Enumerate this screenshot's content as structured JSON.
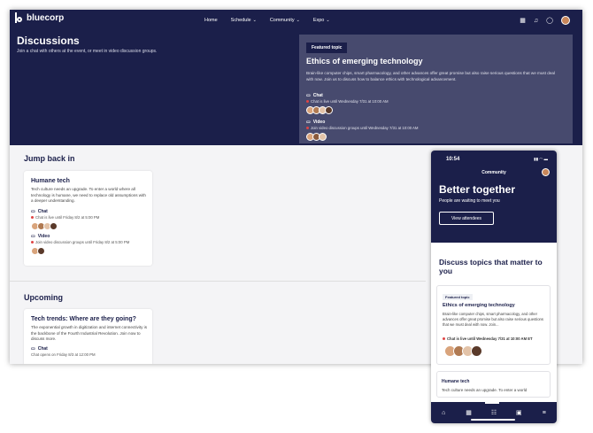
{
  "brand": {
    "name": "bluecorp"
  },
  "nav": {
    "items": [
      {
        "label": "Home"
      },
      {
        "label": "Schedule",
        "has_dropdown": true
      },
      {
        "label": "Community",
        "has_dropdown": true
      },
      {
        "label": "Expo",
        "has_dropdown": true
      }
    ],
    "icons": [
      "calendar-icon",
      "bell-icon",
      "chat-bubble-icon",
      "avatar"
    ]
  },
  "page": {
    "title": "Discussions",
    "subtitle": "Join a chat with others at the event, or meet in video discussion groups."
  },
  "featured": {
    "badge": "Featured topic",
    "title": "Ethics of emerging technology",
    "description": "Brain-like computer chips, smart pharmacology, and other advances offer great promise but also raise serious questions that we must deal with now. Join us to discuss how to balance ethics with technological advancement.",
    "chat_label": "Chat",
    "chat_line": "Chat is live until Wednesday 7/31 at 10:00 AM",
    "video_label": "Video",
    "video_line": "Join video discussion groups until Wednesday 7/31 at 10:00 AM"
  },
  "jump_back_in": {
    "title": "Jump back in",
    "card": {
      "title": "Humane tech",
      "description": "Tech culture needs an upgrade. To enter a world where all technology is humane, we need to replace old assumptions with a deeper understanding.",
      "chat_label": "Chat",
      "chat_line": "Chat is live until Friday 8/2 at 5:00 PM",
      "video_label": "Video",
      "video_line": "Join video discussion groups until Friday 8/2 at 5:00 PM"
    }
  },
  "upcoming": {
    "title": "Upcoming",
    "card": {
      "title": "Tech trends: Where are they going?",
      "description": "The exponential growth in digitization and internet connectivity is the backbone of the Fourth Industrial Revolution. Join now to discuss more.",
      "chat_label": "Chat",
      "chat_line": "Chat opens on Friday 8/3 at 12:00 PM"
    }
  },
  "phone": {
    "time": "10:54",
    "header": "Community",
    "hero_title": "Better together",
    "hero_subtitle": "People are waiting to meet you",
    "button": "View attendees",
    "section_title": "Discuss topics that matter to you",
    "card": {
      "badge": "Featured topic",
      "title": "Ethics of emerging technology",
      "description": "Brain-like computer chips, smart pharmacology, and other advances offer great promise but also raise serious questions that we must deal with now. Join...",
      "line": "Chat is live until Wednesday 7/31 at 10:00 AM ET"
    },
    "card2": {
      "title": "Humane tech",
      "description": "Tech culture needs an upgrade. To enter a world"
    },
    "tabs": [
      "home-icon",
      "calendar-icon",
      "people-icon",
      "expo-icon",
      "menu-icon"
    ]
  },
  "colors": {
    "navy": "#1b1f4a",
    "featured_panel": "#474a6e",
    "live_dot": "#e04545"
  }
}
